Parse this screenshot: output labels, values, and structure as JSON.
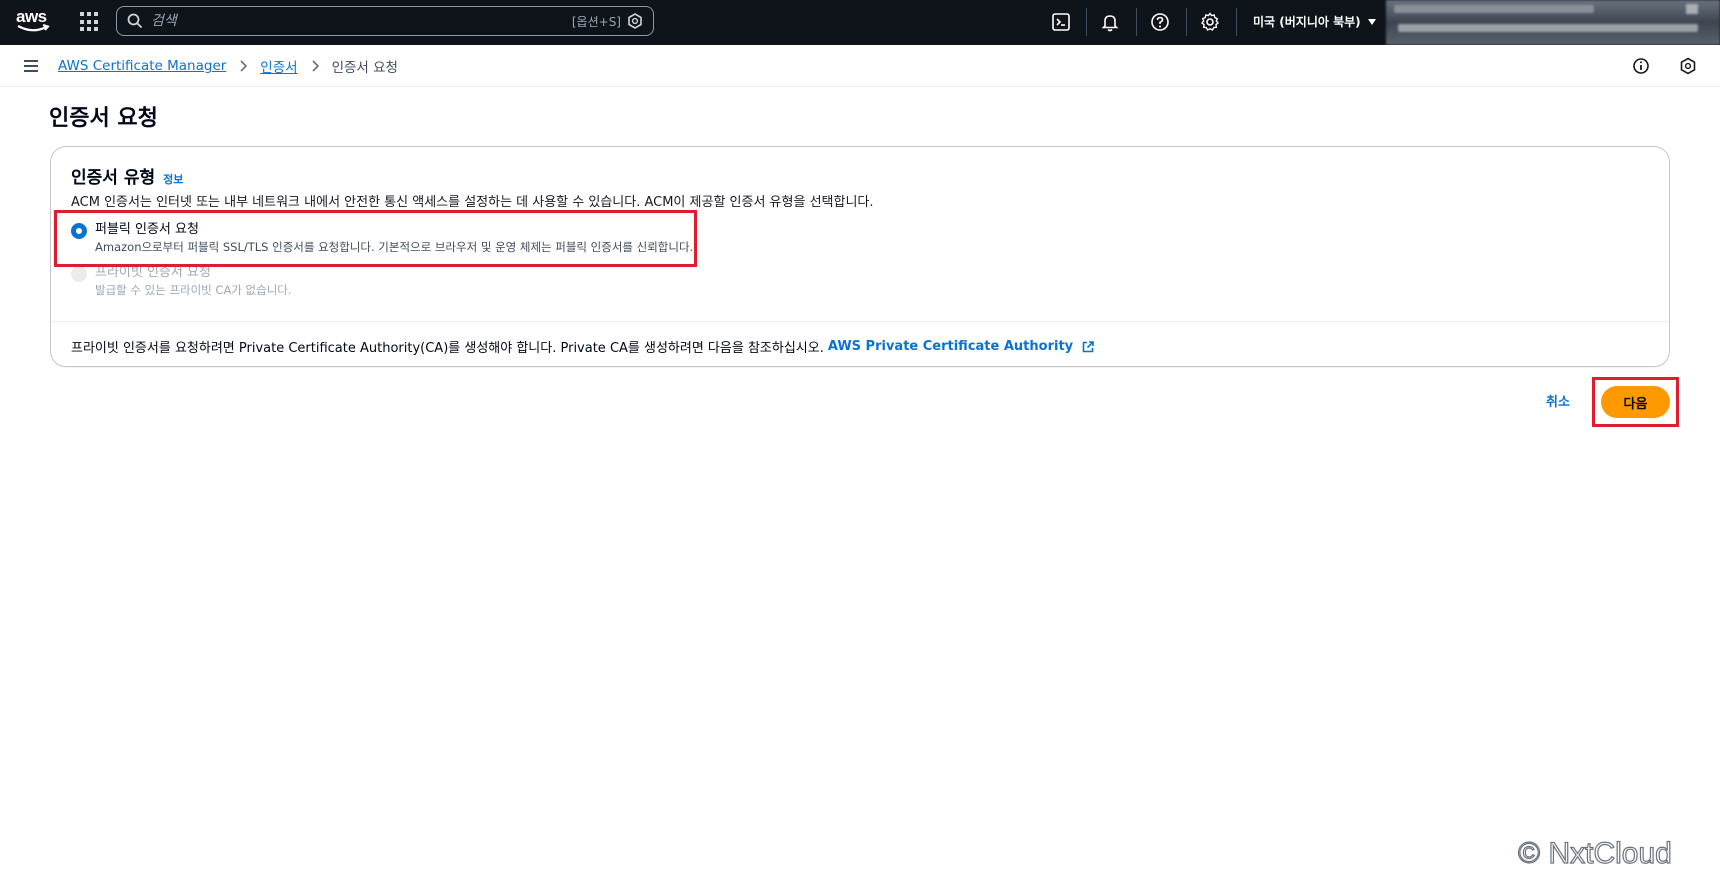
{
  "topnav": {
    "logo_text": "aws",
    "search": {
      "placeholder": "검색",
      "shortcut": "[옵션+S]"
    },
    "region": "미국 (버지니아 북부)",
    "icons": [
      "apps-grid-icon",
      "cloudshell-icon",
      "bell-icon",
      "help-icon",
      "gear-icon"
    ]
  },
  "breadcrumb": {
    "items": [
      {
        "label": "AWS Certificate Manager",
        "link": true
      },
      {
        "label": "인증서",
        "link": true
      },
      {
        "label": "인증서 요청",
        "link": false
      }
    ]
  },
  "page": {
    "title": "인증서 요청"
  },
  "section": {
    "title": "인증서 유형",
    "info_link": "정보",
    "description": "ACM 인증서는 인터넷 또는 내부 네트워크 내에서 안전한 통신 액세스를 설정하는 데 사용할 수 있습니다. ACM이 제공할 인증서 유형을 선택합니다.",
    "options": [
      {
        "label": "퍼블릭 인증서 요청",
        "description": "Amazon으로부터 퍼블릭 SSL/TLS 인증서를 요청합니다. 기본적으로 브라우저 및 운영 체제는 퍼블릭 인증서를 신뢰합니다.",
        "selected": true,
        "disabled": false
      },
      {
        "label": "프라이빗 인증서 요청",
        "description": "발급할 수 있는 프라이빗 CA가 없습니다.",
        "selected": false,
        "disabled": true
      }
    ],
    "footer_text": "프라이빗 인증서를 요청하려면 Private Certificate Authority(CA)를 생성해야 합니다. Private CA를 생성하려면 다음을 참조하십시오.",
    "footer_link": "AWS Private Certificate Authority"
  },
  "actions": {
    "cancel": "취소",
    "next": "다음"
  },
  "watermark": "© NxtCloud",
  "colors": {
    "accent": "#0972d3",
    "primary_button": "#ff9900",
    "highlight": "#e01d2e",
    "nav_bg": "#0f141a"
  }
}
